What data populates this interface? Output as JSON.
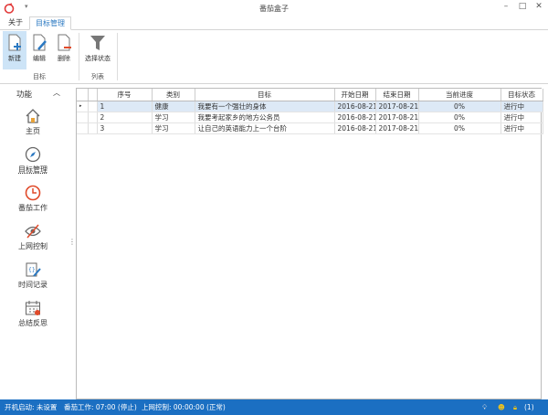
{
  "app": {
    "title": "番茄盒子"
  },
  "tabs": [
    {
      "label": "关于"
    },
    {
      "label": "目标管理"
    }
  ],
  "ribbon": {
    "buttons": [
      {
        "label": "新建",
        "icon": "new-document-icon"
      },
      {
        "label": "编辑",
        "icon": "edit-document-icon"
      },
      {
        "label": "删除",
        "icon": "delete-document-icon"
      },
      {
        "label": "选择状态",
        "icon": "filter-icon"
      }
    ],
    "groups": [
      {
        "label": "目标"
      },
      {
        "label": "列表"
      }
    ]
  },
  "leftpanel": {
    "header": "功能",
    "items": [
      {
        "label": "主页",
        "icon": "home-icon"
      },
      {
        "label": "目标管理",
        "icon": "compass-icon"
      },
      {
        "label": "番茄工作",
        "icon": "clock-icon"
      },
      {
        "label": "上网控制",
        "icon": "eye-hidden-icon"
      },
      {
        "label": "时间记录",
        "icon": "notes-edit-icon"
      },
      {
        "label": "总结反思",
        "icon": "calendar-icon"
      }
    ]
  },
  "grid": {
    "columns": [
      "",
      "",
      "序号",
      "类别",
      "目标",
      "开始日期",
      "结束日期",
      "当前进度",
      "目标状态"
    ],
    "rows": [
      {
        "no": "1",
        "category": "健康",
        "goal": "我要有一个强壮的身体",
        "start": "2016-08-21",
        "end": "2017-08-21",
        "progress": "0%",
        "status": "进行中"
      },
      {
        "no": "2",
        "category": "学习",
        "goal": "我要考起家乡的地方公务员",
        "start": "2016-08-21",
        "end": "2017-08-21",
        "progress": "0%",
        "status": "进行中"
      },
      {
        "no": "3",
        "category": "学习",
        "goal": "让自己的英语能力上一个台阶",
        "start": "2016-08-21",
        "end": "2017-08-21",
        "progress": "0%",
        "status": "进行中"
      }
    ]
  },
  "status": {
    "startup": "开机启动: 未设置",
    "pomodoro": "番茄工作: 07:00 (停止)",
    "internet": "上网控制: 00:00:00 (正常)",
    "count": "(1)"
  },
  "colors": {
    "accent": "#2b79c2",
    "statusbar": "#1b6fc2",
    "selection": "#cde4f7"
  }
}
